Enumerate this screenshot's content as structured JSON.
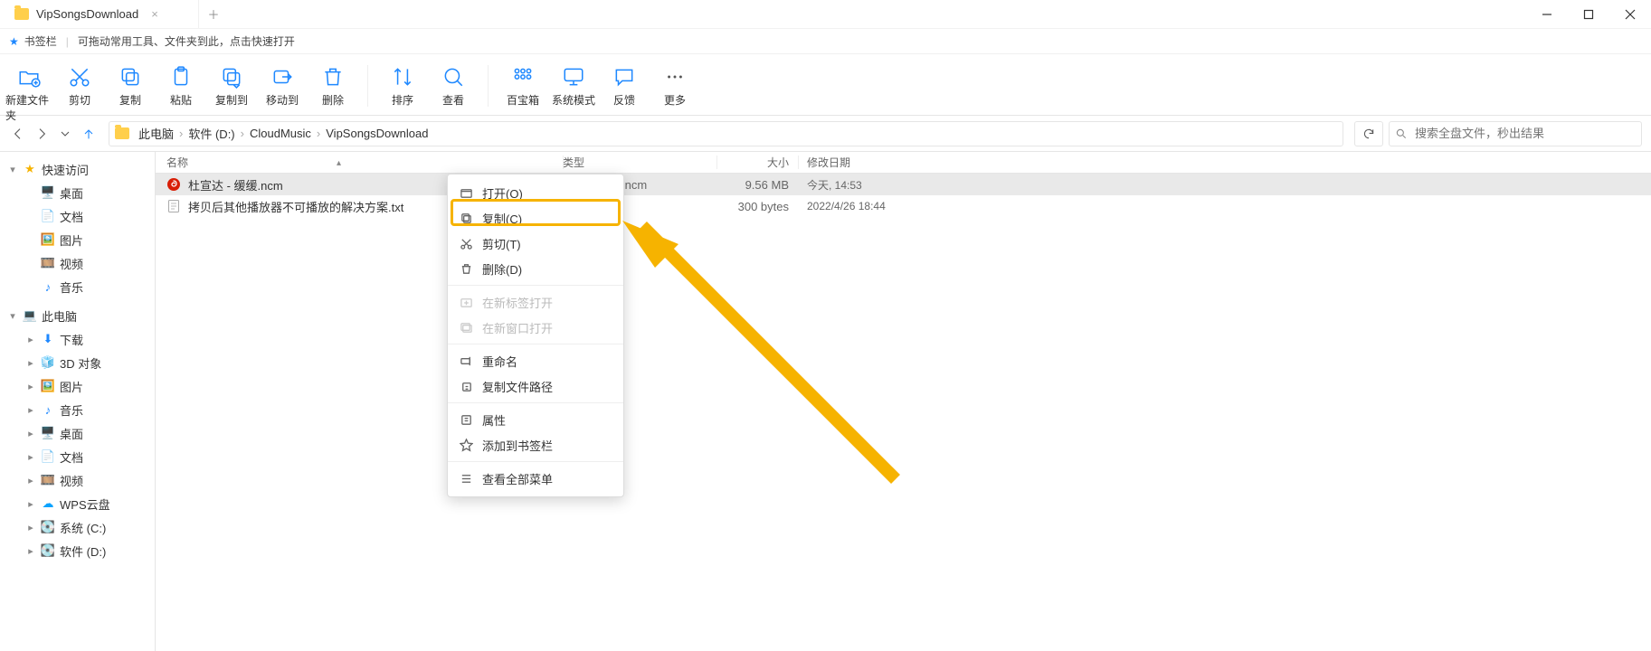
{
  "window": {
    "title": "VipSongsDownload"
  },
  "bookmark_strip": {
    "label": "书签栏",
    "hint": "可拖动常用工具、文件夹到此，点击快速打开"
  },
  "ribbon": {
    "new_folder": "新建文件夹",
    "cut": "剪切",
    "copy": "复制",
    "paste": "粘贴",
    "copy_to": "复制到",
    "move_to": "移动到",
    "delete": "删除",
    "sort": "排序",
    "view": "查看",
    "treasure": "百宝箱",
    "system_mode": "系统模式",
    "feedback": "反馈",
    "more": "更多"
  },
  "breadcrumb": {
    "items": [
      "此电脑",
      "软件 (D:)",
      "CloudMusic",
      "VipSongsDownload"
    ]
  },
  "search": {
    "placeholder": "搜索全盘文件，秒出结果"
  },
  "sidebar": {
    "quick": "快速访问",
    "quick_items": [
      "桌面",
      "文档",
      "图片",
      "视频",
      "音乐"
    ],
    "this_pc": "此电脑",
    "pc_items": [
      "下载",
      "3D 对象",
      "图片",
      "音乐",
      "桌面",
      "文档",
      "视频",
      "WPS云盘",
      "系统 (C:)",
      "软件 (D:)"
    ]
  },
  "columns": {
    "name": "名称",
    "type": "类型",
    "size": "大小",
    "date": "修改日期"
  },
  "files": [
    {
      "name": "杜宣达 - 缓缓.ncm",
      "type": "cloudmusic.ncm",
      "size": "9.56 MB",
      "date": "今天, 14:53",
      "selected": true,
      "icon": "ncm"
    },
    {
      "name": "拷贝后其他播放器不可播放的解决方案.txt",
      "type": "",
      "size": "300 bytes",
      "date": "2022/4/26 18:44",
      "selected": false,
      "icon": "txt"
    }
  ],
  "context_menu": {
    "open": "打开(O)",
    "copy": "复制(C)",
    "cut": "剪切(T)",
    "delete": "删除(D)",
    "new_tab": "在新标签打开",
    "new_window": "在新窗口打开",
    "rename": "重命名",
    "copy_path": "复制文件路径",
    "properties": "属性",
    "add_bookmark": "添加到书签栏",
    "all_menu": "查看全部菜单"
  }
}
